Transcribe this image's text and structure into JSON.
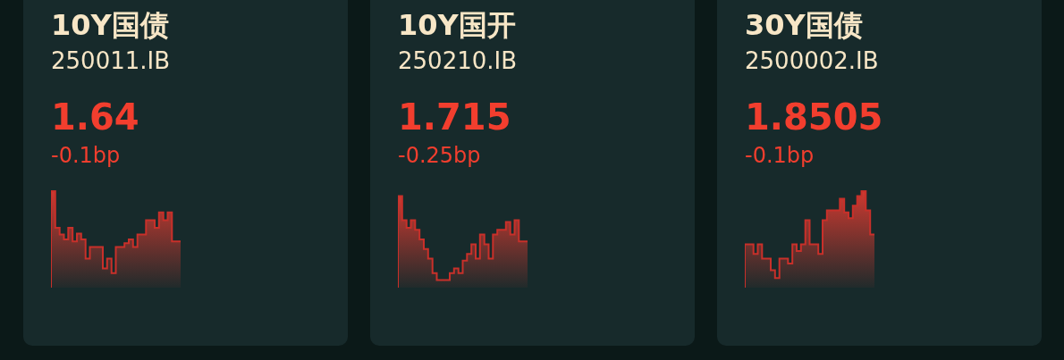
{
  "cards": [
    {
      "name": "10Y国债",
      "code": "250011.IB",
      "price": "1.64",
      "change": "-0.1bp"
    },
    {
      "name": "10Y国开",
      "code": "250210.IB",
      "price": "1.715",
      "change": "-0.25bp"
    },
    {
      "name": "30Y国债",
      "code": "2500002.IB",
      "price": "1.8505",
      "change": "-0.1bp"
    }
  ]
}
